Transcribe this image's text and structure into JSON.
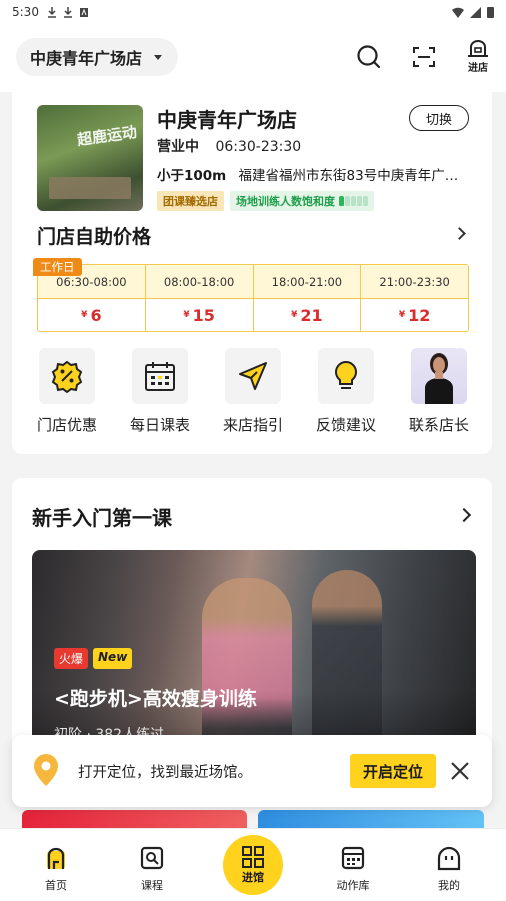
{
  "status_bar": {
    "time": "5:30"
  },
  "header": {
    "store_selector": "中庚青年广场店",
    "checkin_label": "进店"
  },
  "store": {
    "name": "中庚青年广场店",
    "switch_label": "切换",
    "status": "营业中",
    "hours": "06:30-23:30",
    "distance": "小于100m",
    "address": "福建省福州市东街83号中庚青年广…",
    "tag_selected": "团课臻选店",
    "tag_occupancy": "场地训练人数饱和度",
    "logo_text": "超鹿运动"
  },
  "pricing": {
    "title": "门店自助价格",
    "badge": "工作日",
    "currency": "¥",
    "slots": [
      {
        "time": "06:30-08:00",
        "price": "6"
      },
      {
        "time": "08:00-18:00",
        "price": "15"
      },
      {
        "time": "18:00-21:00",
        "price": "21"
      },
      {
        "time": "21:00-23:30",
        "price": "12"
      }
    ]
  },
  "quick_actions": [
    {
      "label": "门店优惠",
      "icon": "discount-icon"
    },
    {
      "label": "每日课表",
      "icon": "calendar-icon"
    },
    {
      "label": "来店指引",
      "icon": "navigation-icon"
    },
    {
      "label": "反馈建议",
      "icon": "lightbulb-icon"
    },
    {
      "label": "联系店长",
      "icon": "manager-avatar"
    }
  ],
  "beginner": {
    "title": "新手入门第一课",
    "course": {
      "badge_hot": "火爆",
      "badge_new": "New",
      "name": "<跑步机>高效瘦身训练",
      "subtitle": "初阶 · 382人练过"
    }
  },
  "location_prompt": {
    "text": "打开定位，找到最近场馆。",
    "button": "开启定位"
  },
  "tabbar": {
    "tabs": [
      {
        "label": "首页",
        "icon": "home-icon"
      },
      {
        "label": "课程",
        "icon": "course-icon"
      },
      {
        "label": "进馆",
        "icon": "checkin-icon"
      },
      {
        "label": "动作库",
        "icon": "exercise-library-icon"
      },
      {
        "label": "我的",
        "icon": "profile-icon"
      }
    ]
  },
  "colors": {
    "accent": "#ffd21d",
    "price_red": "#d92d2d",
    "orange": "#f08a17"
  }
}
